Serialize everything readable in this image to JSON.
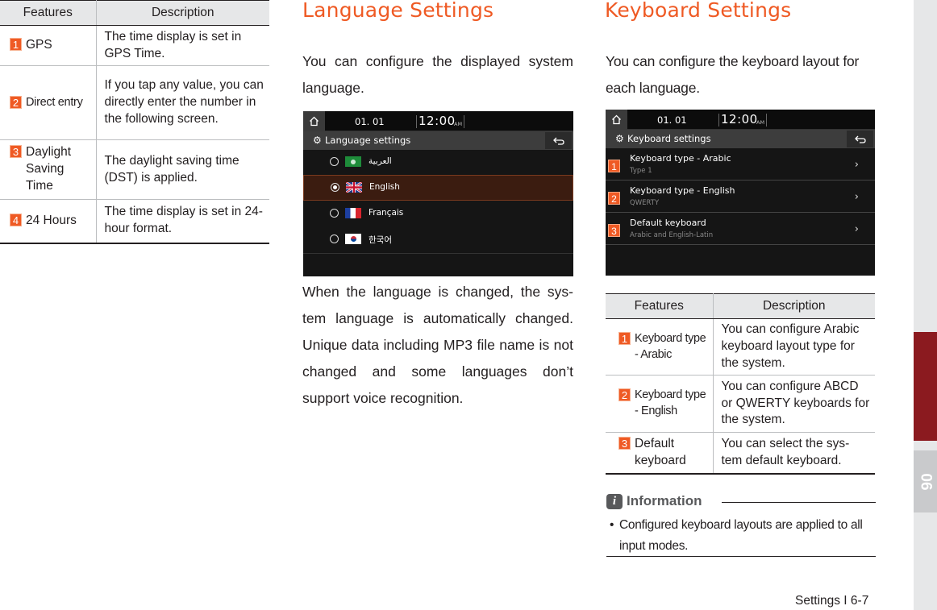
{
  "left_table": {
    "headers": [
      "Features",
      "Description"
    ],
    "rows": [
      {
        "num": "1",
        "feature": "GPS",
        "description": "The time display is set in GPS Time."
      },
      {
        "num": "2",
        "feature": "Direct entry",
        "description": "If you tap any value, you can directly enter the number in the following screen."
      },
      {
        "num": "3",
        "feature": "Daylight Saving Time",
        "description": "The daylight saving time (DST) is applied."
      },
      {
        "num": "4",
        "feature": "24 Hours",
        "description": "The time display is set in 24-hour format."
      }
    ]
  },
  "language": {
    "heading": "Language Settings",
    "intro": "You can configure the displayed system language.",
    "body": "When the language is changed, the sys- tem language is automatically changed. Unique data including MP3 file name is not changed and some languages don’t support voice recognition.",
    "screen": {
      "date": "01. 01",
      "time": "12:00",
      "ampm": "AM",
      "title": "Language settings",
      "options": [
        {
          "label": "العربية",
          "selected": false,
          "flag": "saudi"
        },
        {
          "label": "English",
          "selected": true,
          "flag": "uk"
        },
        {
          "label": "Français",
          "selected": false,
          "flag": "france"
        },
        {
          "label": "한국어",
          "selected": false,
          "flag": "korea"
        }
      ]
    }
  },
  "keyboard": {
    "heading": "Keyboard Settings",
    "intro": "You can configure the keyboard layout for each language.",
    "screen": {
      "date": "01. 01",
      "time": "12:00",
      "ampm": "AM",
      "title": "Keyboard settings",
      "items": [
        {
          "num": "1",
          "title": "Keyboard type - Arabic",
          "sub": "Type 1"
        },
        {
          "num": "2",
          "title": "Keyboard type - English",
          "sub": "QWERTY"
        },
        {
          "num": "3",
          "title": "Default keyboard",
          "sub": "Arabic and English-Latin"
        }
      ]
    },
    "table": {
      "headers": [
        "Features",
        "Description"
      ],
      "rows": [
        {
          "num": "1",
          "feature": "Keyboard type - Arabic",
          "description": "You can configure Arabic keyboard layout type for the system."
        },
        {
          "num": "2",
          "feature": "Keyboard type - English",
          "description": "You can configure ABCD or QWERTY keyboards for the system."
        },
        {
          "num": "3",
          "feature": "Default keyboard",
          "description": "You can select the sys- tem default keyboard."
        }
      ]
    },
    "info": {
      "icon": "i",
      "title": "Information",
      "bullet": "Configured keyboard layouts are applied to all input modes."
    }
  },
  "footer": {
    "page": "Settings I 6-7"
  },
  "chapter_tab": {
    "number": "06"
  },
  "colors": {
    "accent": "#ef5a24",
    "chapter_red": "#8b1a1f",
    "screen_bg": "#151515"
  }
}
